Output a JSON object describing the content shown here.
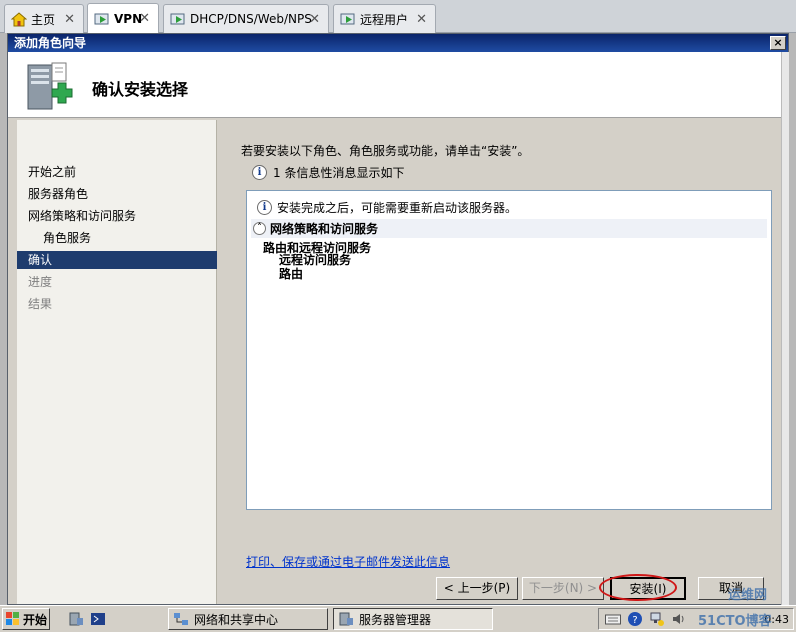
{
  "tabs": [
    {
      "label": "主页",
      "icon": "home-icon",
      "active": false
    },
    {
      "label": "VPN",
      "icon": "vm-icon",
      "active": true
    },
    {
      "label": "DHCP/DNS/Web/NPS",
      "icon": "vm-icon",
      "active": false
    },
    {
      "label": "远程用户",
      "icon": "vm-icon",
      "active": false
    }
  ],
  "tab_close_glyph": "✕",
  "wizard": {
    "title": "添加角色向导",
    "close_glyph": "×",
    "header_title": "确认安装选择"
  },
  "nav": [
    {
      "label": "开始之前",
      "state": "normal"
    },
    {
      "label": "服务器角色",
      "state": "normal"
    },
    {
      "label": "网络策略和访问服务",
      "state": "normal"
    },
    {
      "label": "角色服务",
      "state": "sub"
    },
    {
      "label": "确认",
      "state": "active"
    },
    {
      "label": "进度",
      "state": "disabled"
    },
    {
      "label": "结果",
      "state": "disabled"
    }
  ],
  "content": {
    "instruction": "若要安装以下角色、角色服务或功能，请单击“安装”。",
    "info_count_text": "1 条信息性消息显示如下",
    "restart_notice": "安装完成之后，可能需要重新启动该服务器。",
    "role_name": "网络策略和访问服务",
    "role_services": {
      "parent": "路由和远程访问服务",
      "children": [
        "远程访问服务",
        "路由"
      ]
    },
    "print_link": "打印、保存或通过电子邮件发送此信息"
  },
  "buttons": {
    "prev": "< 上一步(P)",
    "next": "下一步(N) >",
    "install": "安装(I)",
    "cancel": "取消"
  },
  "taskbar": {
    "start": "开始",
    "items": [
      {
        "label": "网络和共享中心",
        "pressed": false
      },
      {
        "label": "服务器管理器",
        "pressed": true
      }
    ],
    "clock": "0:43"
  },
  "watermark": {
    "line1": "运维网",
    "line2": "51CTO博客"
  },
  "colors": {
    "nav_active_bg": "#1e3c6e",
    "link": "#0033cc",
    "highlight_ring": "#d01818"
  }
}
